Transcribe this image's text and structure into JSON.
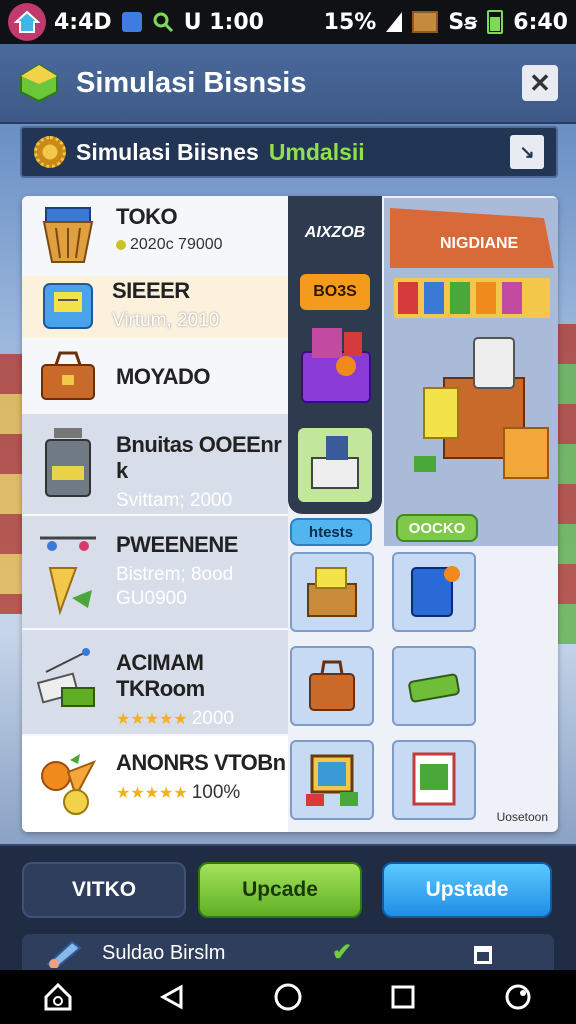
{
  "status_bar": {
    "time_left": "4:4D",
    "center_text": "U 1:00",
    "signal": "15%",
    "network": "Sꞩ",
    "time_right": "6:40"
  },
  "window": {
    "title": "Simulasi Bisnsis",
    "close_glyph": "✕"
  },
  "subheader": {
    "title": "Simulasi Biisnes",
    "highlight": "Umdalsii",
    "action_glyph": "↘"
  },
  "list": {
    "items": [
      {
        "name": "TOKO",
        "sub": "2020c 79000",
        "icon": "basket-icon"
      },
      {
        "name": "SIEEER",
        "sub": "Virtum, 2010",
        "icon": "register-icon",
        "selected": true
      },
      {
        "name": "MOYADO",
        "sub": "",
        "icon": "cash-bag-icon"
      },
      {
        "name": "Bnuitas OOEEnr k",
        "sub": "Svittam; 2000",
        "icon": "jar-icon"
      },
      {
        "name": "PWEENENE",
        "sub": "Bistrem; 8ood",
        "sub2": "GU0900",
        "icon": "scale-icon"
      },
      {
        "name": "ACIMAM TKRoom",
        "stars": "★★★★★",
        "sub": "2000",
        "icon": "money-icon"
      },
      {
        "name": "ANONRS VTOBn",
        "stars": "★★★★★",
        "sub": "100%",
        "icon": "fruit-icon"
      }
    ]
  },
  "middle": {
    "heading": "AIXZOB",
    "badge": "BO3S"
  },
  "pills": {
    "blue": "htests",
    "green": "OOCKO"
  },
  "store": {
    "sign": "NIGDIANE"
  },
  "grid": {
    "corner_tag": "Uosetoon"
  },
  "bottom": {
    "btn_dark": "VITKO",
    "btn_green": "Upcade",
    "btn_blue": "Upstade",
    "row_label": "Suldao Birslm",
    "check": "✔"
  }
}
